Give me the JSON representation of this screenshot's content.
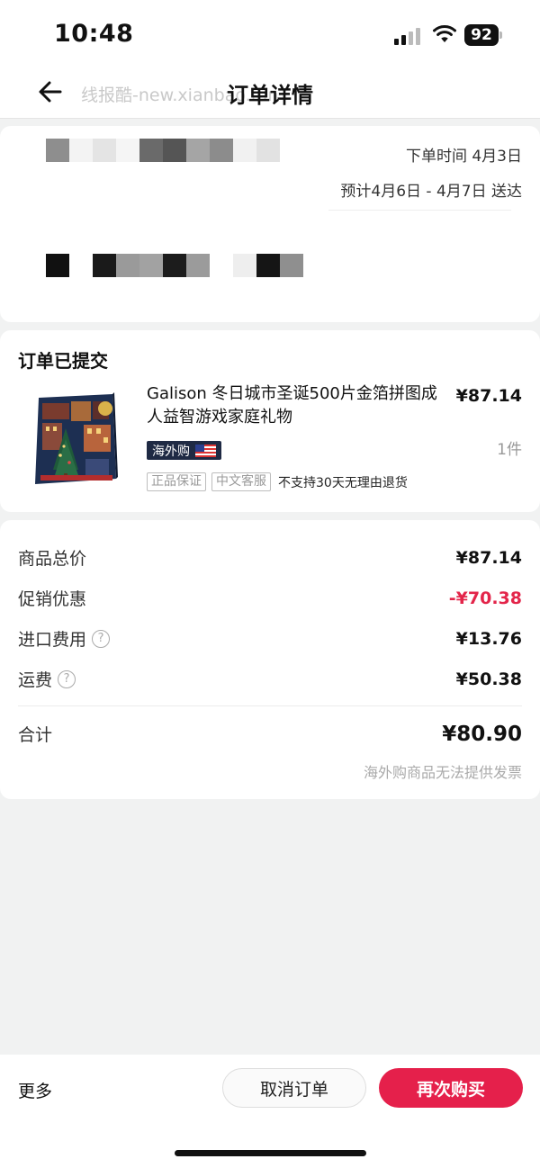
{
  "status_bar": {
    "time": "10:48",
    "battery": "92"
  },
  "nav": {
    "title": "订单详情",
    "watermark": "线报酷-new.xianbao.fun"
  },
  "order_info": {
    "order_time": "下单时间 4月3日",
    "delivery": "预计4月6日 - 4月7日 送达"
  },
  "order_status": "订单已提交",
  "product": {
    "name": "Galison 冬日城市圣诞500片金箔拼图成人益智游戏家庭礼物",
    "price": "¥87.14",
    "quantity": "1件",
    "tag": "海外购",
    "chips": [
      "正品保证",
      "中文客服"
    ],
    "return_policy": "不支持30天无理由退货"
  },
  "summary": {
    "subtotal_label": "商品总价",
    "subtotal": "¥87.14",
    "promo_label": "促销优惠",
    "promo": "-¥70.38",
    "import_label": "进口费用",
    "import_fee": "¥13.76",
    "shipping_label": "运费",
    "shipping": "¥50.38",
    "total_label": "合计",
    "total": "¥80.90",
    "invoice_note": "海外购商品无法提供发票"
  },
  "actions": {
    "more": "更多",
    "cancel": "取消订单",
    "rebuy": "再次购买"
  },
  "colors": {
    "accent": "#e5204b",
    "promo": "#e3254a",
    "tag_bg": "#1f2a44"
  }
}
